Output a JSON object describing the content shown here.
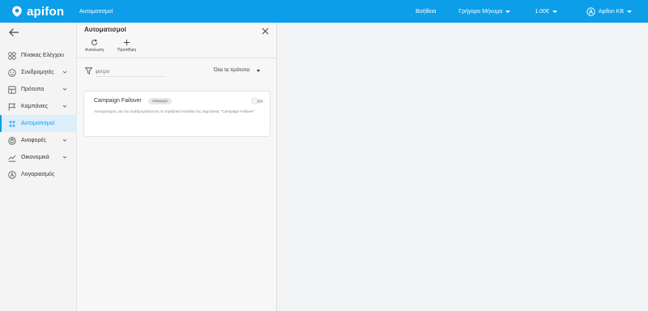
{
  "topbar": {
    "brand": "apifon",
    "app_title": "Αυτοματισμοί",
    "help": "Βοήθεια",
    "quick_message": "Γρήγορο Μήνυμα",
    "balance": "1.00€",
    "account": "Apifon KB",
    "accent_color": "#0d9eea"
  },
  "sidebar": {
    "items": [
      {
        "label": "Πίνακας Ελέγχου",
        "icon": "dashboard-icon",
        "has_chevron": false
      },
      {
        "label": "Συνδρομητές",
        "icon": "subscribers-icon",
        "has_chevron": true
      },
      {
        "label": "Πρότυπα",
        "icon": "templates-icon",
        "has_chevron": true
      },
      {
        "label": "Καμπάνιες",
        "icon": "campaigns-flag-icon",
        "has_chevron": true
      },
      {
        "label": "Αυτοματισμοί",
        "icon": "automations-icon",
        "has_chevron": false,
        "active": true
      },
      {
        "label": "Αναφορές",
        "icon": "reports-icon",
        "has_chevron": true
      },
      {
        "label": "Οικονομικά",
        "icon": "finance-icon",
        "has_chevron": true
      },
      {
        "label": "Λογαριασμός",
        "icon": "account-icon",
        "has_chevron": false
      }
    ]
  },
  "panel": {
    "title": "Αυτοματισμοί",
    "refresh_label": "Ανανέωση",
    "add_label": "Προσθήκη",
    "filter_placeholder": "φίλτρο",
    "template_filter": "Όλα τα πρότυπα",
    "automations": [
      {
        "name": "Campaign Failover",
        "status": "Ανενεργό",
        "enabled": false,
        "description": "Αυτοματισμός για την αναδρομολόγηση σε Εφεδρικά Κανάλια της καμπάνιας \"Campaign Failover\""
      }
    ]
  }
}
